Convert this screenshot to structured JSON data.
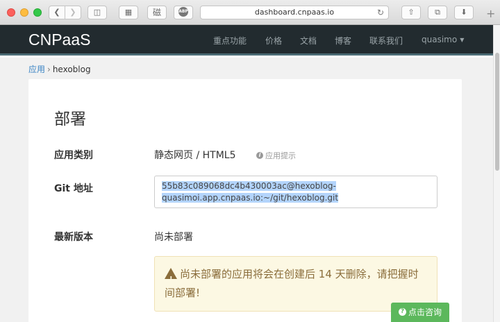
{
  "browser": {
    "url": "dashboard.cnpaas.io",
    "text_button": "磁",
    "abp_badge": "ABP",
    "icons": [
      "back-icon",
      "forward-icon",
      "sidebar-icon",
      "image-icon",
      "abp-icon",
      "reload-icon",
      "share-icon",
      "tabs-icon",
      "download-icon",
      "plus-icon"
    ]
  },
  "navbar": {
    "brand": "CNPaaS",
    "items": [
      "重点功能",
      "价格",
      "文档",
      "博客",
      "联系我们"
    ],
    "user": "quasimo"
  },
  "breadcrumb": {
    "parent": "应用",
    "current": "hexoblog"
  },
  "deploy": {
    "title": "部署",
    "app_type_label": "应用类别",
    "app_type_value": "静态网页 / HTML5",
    "app_hint": "应用提示",
    "git_label": "Git 地址",
    "git_line1": "55b83c089068dc4b430003ac@hexoblog-",
    "git_line2": "quasimoi.app.cnpaas.io:~/git/hexoblog.git",
    "version_label": "最新版本",
    "version_value": "尚未部署",
    "alert_text": "尚未部署的应用将会在创建后 14 天删除，请把握时间部署!"
  },
  "consult_button": "点击咨询",
  "colors": {
    "navbar_bg": "#222b2f",
    "link": "#3b84c4",
    "alert_bg": "#fcf8e3",
    "alert_text": "#8a6d3b",
    "consult_bg": "#5cb85c",
    "selection": "#b3d4fc"
  }
}
